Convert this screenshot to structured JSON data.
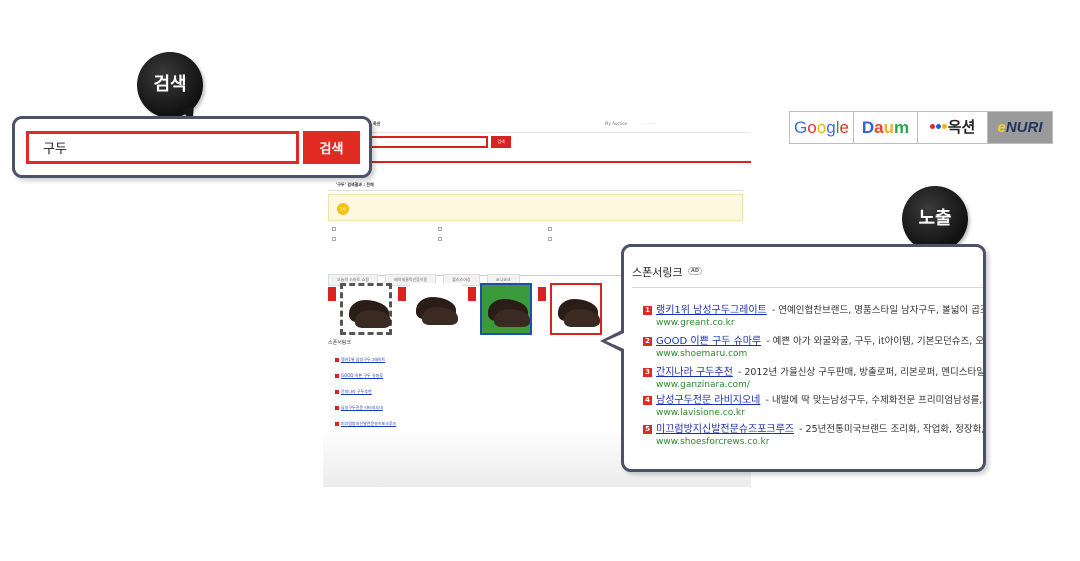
{
  "search": {
    "query": "구두",
    "button_label": "검색",
    "bubble_label": "검색"
  },
  "exposure": {
    "bubble_label": "노출"
  },
  "engines": [
    "Google",
    "Daum",
    "옥션",
    "eNURI"
  ],
  "sponsored": {
    "title": "스폰서링크",
    "badge": "AD",
    "items": [
      {
        "num": "1",
        "title": "랭키1위 남성구두그레이트",
        "desc": "- 연예인협찬브랜드, 명품스타일 남자구두, 볼넓이 곱조절",
        "url": "www.greant.co.kr"
      },
      {
        "num": "2",
        "title": "GOOD 이쁜 구두 슈마루",
        "desc": "- 예쁜 아가 와굴와굴, 구두, it아이템, 기본모던슈즈, 오늘의",
        "url": "www.shoemaru.com"
      },
      {
        "num": "3",
        "title": "간지나라 구두추천",
        "desc": "- 2012년 가을신상 구두판매, 방출로퍼, 리본로퍼, 멘디스타일 구",
        "url": "www.ganzinara.com/"
      },
      {
        "num": "4",
        "title": "남성구두전문 라비지오네",
        "desc": "- 내발에 딱 맞는남성구두, 수제화전문 프리미엄남성를, 초",
        "url": "www.lavisione.co.kr"
      },
      {
        "num": "5",
        "title": "미끄럼방지신발전문슈즈포크루즈",
        "desc": "- 25년전통미국브랜드 조리화, 작업화, 정장화, 운",
        "url": "www.shoesforcrews.co.kr"
      }
    ]
  },
  "background_page": {
    "my_auction": "My Auction",
    "search_btn": "검색",
    "result_text": "'구두' 검색결과 : 전체",
    "ad_badge": "추천",
    "tabs": [
      "오늘의 스마트 쇼핑",
      "패이레클릭인증이용",
      "플러스아상",
      "코니코크"
    ],
    "sponsor_label": "스폰서링크"
  }
}
